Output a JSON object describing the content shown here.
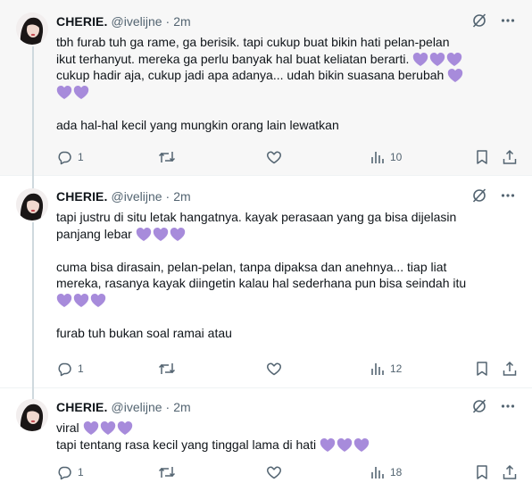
{
  "colors": {
    "heart": "#a78bdb",
    "muted": "#536471",
    "text": "#0f1419",
    "highlight_bg": "#f7f7f7"
  },
  "tweets": [
    {
      "name": "CHERIE.",
      "handle": "@ivelijne",
      "dot": "·",
      "time": "2m",
      "lines": [
        {
          "text": "tbh furab tuh ga rame, ga berisik. tapi cukup buat bikin hati pelan-pelan",
          "hearts": 0
        },
        {
          "text": "ikut terhanyut. mereka ga perlu banyak hal buat keliatan berarti.",
          "hearts": 3
        },
        {
          "text": "cukup hadir aja, cukup jadi apa adanya... udah bikin suasana berubah",
          "hearts": 1
        },
        {
          "text": "",
          "hearts": 2
        },
        {
          "text": "",
          "hearts": 0
        },
        {
          "text": "ada hal-hal kecil yang mungkin orang lain lewatkan",
          "hearts": 0
        }
      ],
      "replies": "1",
      "views": "10"
    },
    {
      "name": "CHERIE.",
      "handle": "@ivelijne",
      "dot": "·",
      "time": "2m",
      "lines": [
        {
          "text": "tapi justru di situ letak hangatnya. kayak perasaan yang ga bisa dijelasin",
          "hearts": 0
        },
        {
          "text": "panjang lebar",
          "hearts": 3
        },
        {
          "text": "",
          "hearts": 0
        },
        {
          "text": "cuma bisa dirasain, pelan-pelan, tanpa dipaksa dan anehnya... tiap liat",
          "hearts": 0
        },
        {
          "text": "mereka, rasanya kayak diingetin kalau hal sederhana pun bisa seindah itu",
          "hearts": 0
        },
        {
          "text": "",
          "hearts": 3
        },
        {
          "text": "",
          "hearts": 0
        },
        {
          "text": "furab tuh bukan soal ramai atau",
          "hearts": 0
        }
      ],
      "replies": "1",
      "views": "12"
    },
    {
      "name": "CHERIE.",
      "handle": "@ivelijne",
      "dot": "·",
      "time": "2m",
      "lines": [
        {
          "text": "viral",
          "hearts": 3
        },
        {
          "text": "tapi tentang rasa kecil yang tinggal lama di hati",
          "hearts": 3
        }
      ],
      "replies": "1",
      "views": "18"
    }
  ]
}
